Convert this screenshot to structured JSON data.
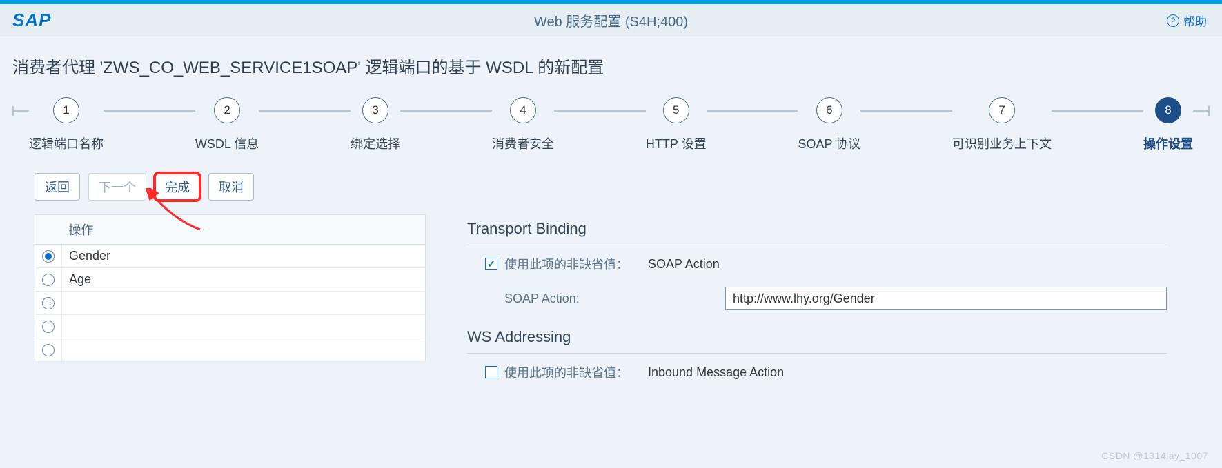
{
  "shell": {
    "logo_text": "SAP",
    "title": "Web 服务配置 (S4H;400)",
    "help_label": "帮助"
  },
  "page": {
    "heading": "消费者代理 'ZWS_CO_WEB_SERVICE1SOAP' 逻辑端口的基于 WSDL 的新配置"
  },
  "wizard": {
    "steps": [
      {
        "num": "1",
        "label": "逻辑端口名称"
      },
      {
        "num": "2",
        "label": "WSDL 信息"
      },
      {
        "num": "3",
        "label": "绑定选择"
      },
      {
        "num": "4",
        "label": "消费者安全"
      },
      {
        "num": "5",
        "label": "HTTP 设置"
      },
      {
        "num": "6",
        "label": "SOAP 协议"
      },
      {
        "num": "7",
        "label": "可识别业务上下文"
      },
      {
        "num": "8",
        "label": "操作设置"
      }
    ],
    "active_index": 7
  },
  "actions": {
    "back": "返回",
    "next": "下一个",
    "finish": "完成",
    "cancel": "取消"
  },
  "operations": {
    "header": "操作",
    "rows": [
      {
        "label": "Gender",
        "selected": true
      },
      {
        "label": "Age",
        "selected": false
      },
      {
        "label": "",
        "selected": false
      },
      {
        "label": "",
        "selected": false
      },
      {
        "label": "",
        "selected": false
      }
    ]
  },
  "transport": {
    "section_title": "Transport Binding",
    "use_nondefault_label": "使用此项的非缺省值：",
    "use_nondefault_value": "SOAP Action",
    "use_nondefault_checked": true,
    "soap_action_label": "SOAP Action:",
    "soap_action_value": "http://www.lhy.org/Gender"
  },
  "wsaddr": {
    "section_title": "WS Addressing",
    "use_nondefault_label": "使用此项的非缺省值：",
    "use_nondefault_value": "Inbound Message Action",
    "use_nondefault_checked": false
  },
  "watermark": "CSDN @1314lay_1007"
}
